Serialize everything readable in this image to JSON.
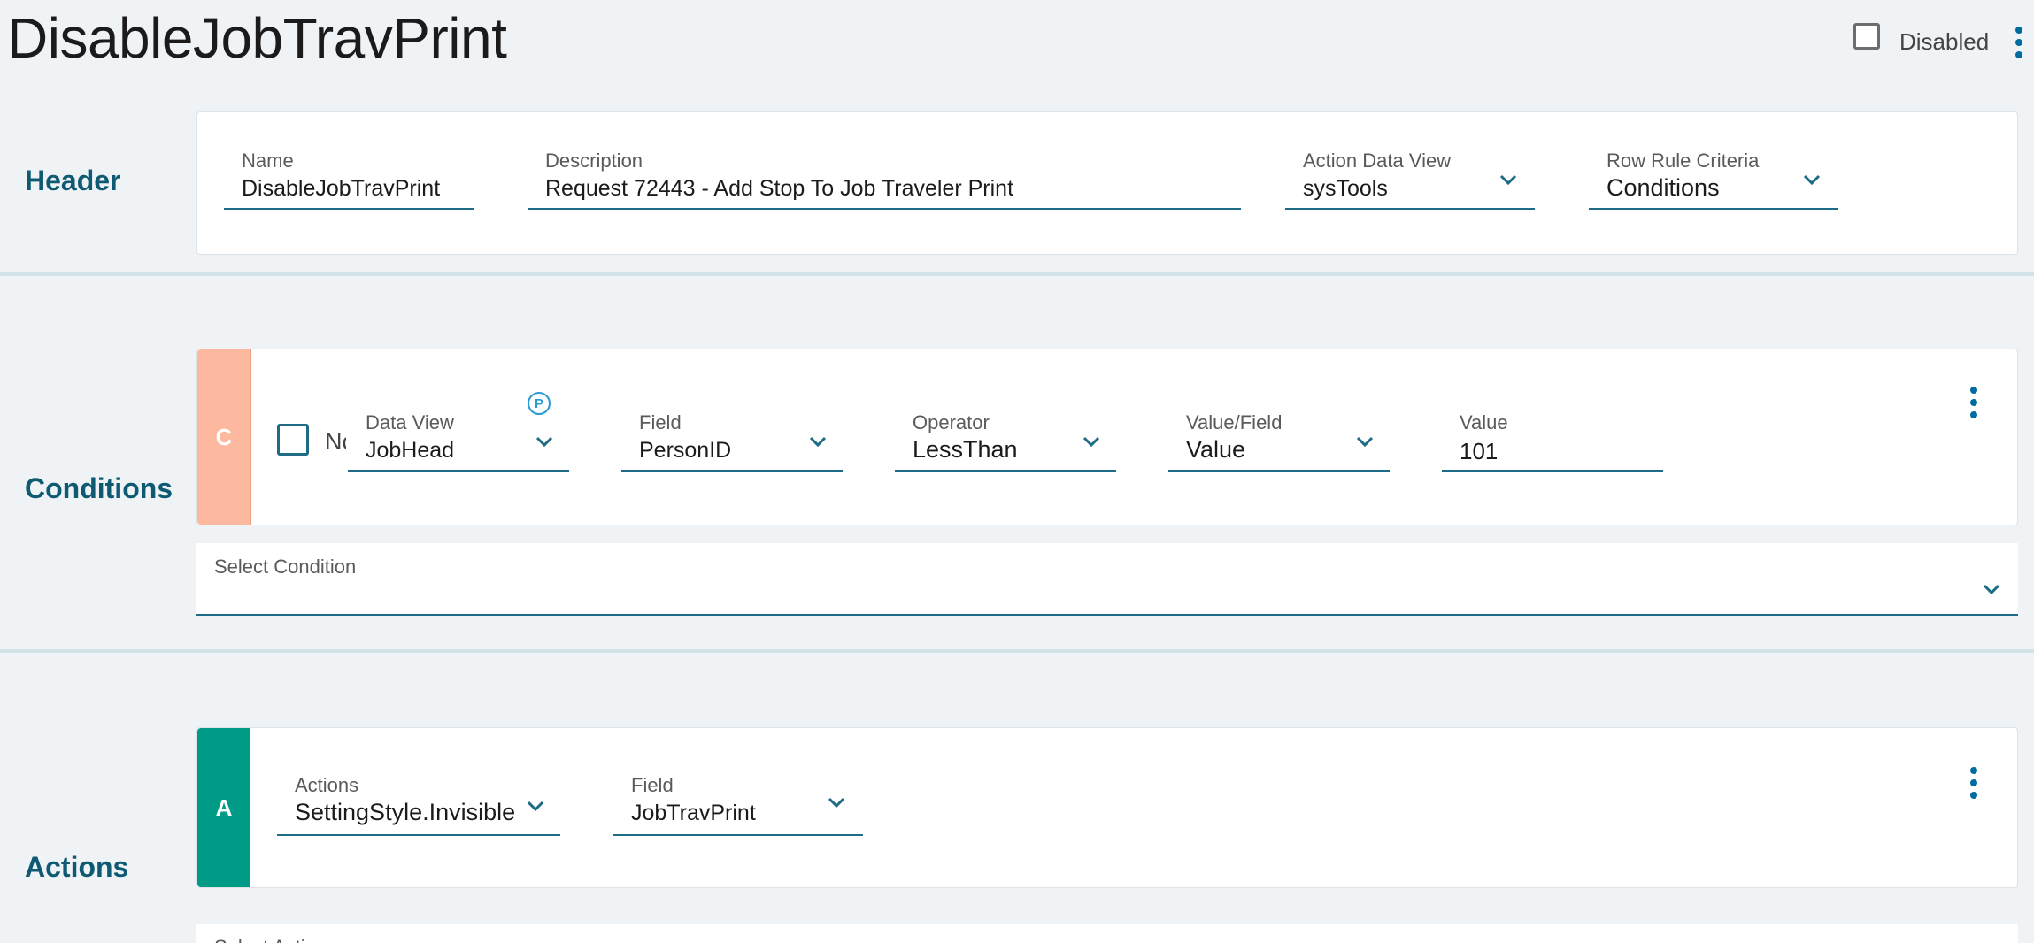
{
  "page": {
    "title": "DisableJobTravPrint"
  },
  "top_controls": {
    "disabled_label": "Disabled",
    "disabled_checked": false,
    "menu_icon": "kebab-vertical-icon"
  },
  "sections": {
    "header": "Header",
    "conditions": "Conditions",
    "actions": "Actions"
  },
  "header": {
    "name": {
      "label": "Name",
      "value": "DisableJobTravPrint"
    },
    "description": {
      "label": "Description",
      "value": "Request 72443 - Add Stop To Job Traveler Print"
    },
    "action_data_view": {
      "label": "Action Data View",
      "value": "sysTools"
    },
    "row_rule_criteria": {
      "label": "Row Rule Criteria",
      "value": "Conditions"
    }
  },
  "condition": {
    "tag": "C",
    "not_label": "Nc",
    "badge": "P",
    "data_view": {
      "label": "Data View",
      "value": "JobHead"
    },
    "field": {
      "label": "Field",
      "value": "PersonID"
    },
    "operator": {
      "label": "Operator",
      "value": "LessThan"
    },
    "value_field": {
      "label": "Value/Field",
      "value": "Value"
    },
    "value": {
      "label": "Value",
      "value": "101"
    }
  },
  "select_condition": {
    "label": "Select Condition"
  },
  "action": {
    "tag": "A",
    "actions": {
      "label": "Actions",
      "value": "SettingStyle.Invisible"
    },
    "field": {
      "label": "Field",
      "value": "JobTravPrint"
    }
  },
  "select_action": {
    "label": "Select Action"
  },
  "colors": {
    "accent": "#1e6b86",
    "section_label": "#0e5a72",
    "condition_tag": "#fdb9a0",
    "action_tag": "#009b86",
    "kebab": "#006b9e",
    "background": "#eff3f6"
  }
}
